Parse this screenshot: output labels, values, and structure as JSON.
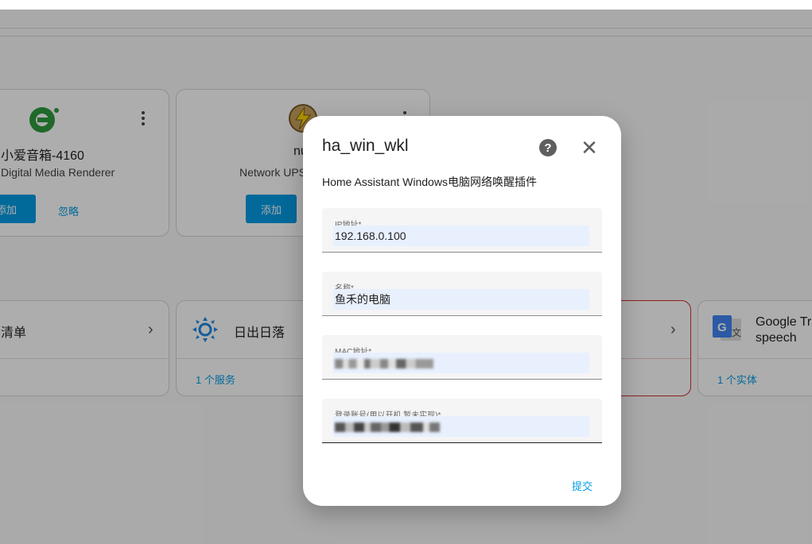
{
  "discovered": [
    {
      "title": "小爱音箱-4160",
      "subtitle": "Digital Media Renderer",
      "add_label": "添加",
      "ignore_label": "忽略"
    },
    {
      "title": "nu",
      "subtitle": "Network UPS",
      "add_label": "添加"
    }
  ],
  "integrations": [
    {
      "title": "清单"
    },
    {
      "title": "日出日落",
      "link": "1 个服务"
    },
    {
      "title": ""
    },
    {
      "title": "Google Tra\nspeech",
      "title_line1": "Google Tra",
      "title_line2": "speech",
      "link": "1 个实体"
    }
  ],
  "dialog": {
    "title": "ha_win_wkl",
    "description": "Home Assistant Windows电脑网络唤醒插件",
    "fields": [
      {
        "label": "IP地址*",
        "value": "192.168.0.100"
      },
      {
        "label": "名称*",
        "value": "鱼禾的电脑"
      },
      {
        "label": "MAC地址*",
        "value": ""
      },
      {
        "label": "登录账号(用以开机,暂未实现)*",
        "value": ""
      }
    ],
    "submit_label": "提交"
  },
  "icons": {
    "help": "help-circle-icon",
    "close": "close-icon",
    "menu": "dots-vertical-icon",
    "chevron": "chevron-right-icon"
  },
  "colors": {
    "accent": "#039be5",
    "error_border": "#d32f2f"
  }
}
